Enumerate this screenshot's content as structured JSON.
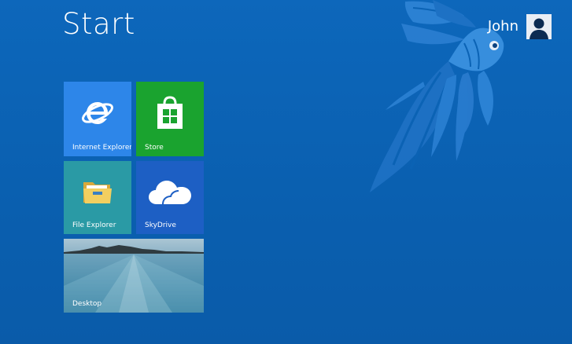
{
  "screen": {
    "title": "Start",
    "background_color": "#0b63b5"
  },
  "user": {
    "name": "John",
    "avatar_icon": "user-silhouette-icon"
  },
  "tiles": [
    {
      "label": "Internet Explorer",
      "icon": "internet-explorer-icon",
      "color": "#2d86e9"
    },
    {
      "label": "Store",
      "icon": "store-bag-icon",
      "color": "#1aa32f"
    },
    {
      "label": "File Explorer",
      "icon": "folder-icon",
      "color": "#2a9aa5"
    },
    {
      "label": "SkyDrive",
      "icon": "cloud-icon",
      "color": "#1d5fc4"
    },
    {
      "label": "Desktop",
      "icon": "landscape-wallpaper",
      "color": "#3f84a3"
    }
  ]
}
